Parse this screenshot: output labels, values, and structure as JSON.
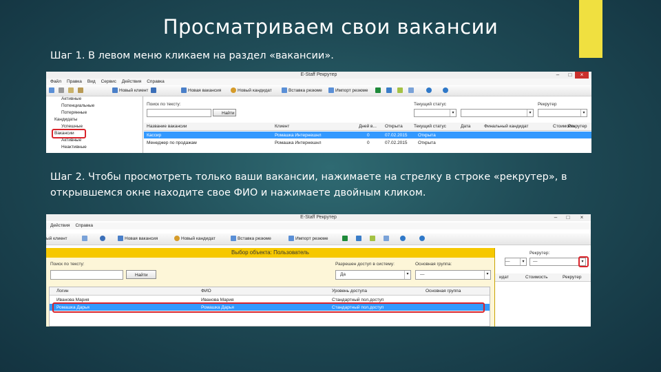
{
  "slide": {
    "title": "Просматриваем свои вакансии",
    "step1": "Шаг 1. В левом меню кликаем на раздел «вакансии».",
    "step2": "Шаг 2. Чтобы просмотреть только ваши вакансии, нажимаете на стрелку в строке «рекрутер», в открывшемся окне находите свое ФИО и нажимаете двойным кликом."
  },
  "colors": {
    "accent": "#f0e040",
    "highlight": "#d9232a",
    "selection": "#3399ff",
    "dialog_title": "#f6c800"
  },
  "screenshot1": {
    "window_title": "E-Staff Рекрутер",
    "menu": [
      "Файл",
      "Правка",
      "Вид",
      "Сервис",
      "Действия",
      "Справка"
    ],
    "toolbar": {
      "new_client": "Новый клиент",
      "new_vacancy": "Новая вакансия",
      "new_candidate": "Новый кандидат",
      "insert_resume": "Вставка резюме",
      "import_resume": "Импорт резюме"
    },
    "tree": [
      "Активные",
      "Потенциальные",
      "Потерянные",
      "Кандидаты",
      "Успешные",
      "Вакансии",
      "Активные",
      "Неактивные"
    ],
    "filters": {
      "search_label": "Поиск по тексту:",
      "find_button": "Найти",
      "status_label": "Текущий статус",
      "recruiter_label": "Рекрутер"
    },
    "columns": [
      "Название вакансии",
      "Клиент",
      "Дней в...",
      "Открыта",
      "Текущий статус",
      "Дата",
      "Финальный кандидат",
      "Стоимость",
      "Рекрутер"
    ],
    "rows": [
      {
        "name": "Кассир",
        "client": "Ромашка Интернешнл",
        "days": "0",
        "opened": "07.02.2015",
        "status": "Открыта"
      },
      {
        "name": "Менеджер по продажам",
        "client": "Ромашка Интернешнл",
        "days": "0",
        "opened": "07.02.2015",
        "status": "Открыта"
      }
    ]
  },
  "screenshot2": {
    "window_title": "E-Staff Рекрутер",
    "menu": [
      "Действия",
      "Справка"
    ],
    "toolbar": {
      "new_client": "ый клиент",
      "new_vacancy": "Новая вакансия",
      "new_candidate": "Новый кандидат",
      "insert_resume": "Вставка резюме",
      "import_resume": "Импорт резюме"
    },
    "recruiter_label": "Рекрутер:",
    "recruiter_value": "—",
    "first_value": "—",
    "bg_columns": [
      "идат",
      "Стоимость",
      "Рекрутер"
    ],
    "dialog": {
      "title": "Выбор объекта: Пользователь",
      "search_label": "Поиск по тексту:",
      "find_button": "Найти",
      "access_label": "Разрешен доступ в систему:",
      "access_value": "Да",
      "group_label": "Основная группа:",
      "group_value": "—",
      "columns": [
        "Логин",
        "ФИО",
        "Уровень доступа",
        "Основная группа"
      ],
      "rows": [
        {
          "login": "Иванова Мария",
          "fio": "Иванова Мария",
          "level": "Стандартный пол.доступ"
        },
        {
          "login": "Ромашка Дарья",
          "fio": "Ромашка Дарья",
          "level": "Стандартный пол.доступ"
        }
      ]
    }
  }
}
